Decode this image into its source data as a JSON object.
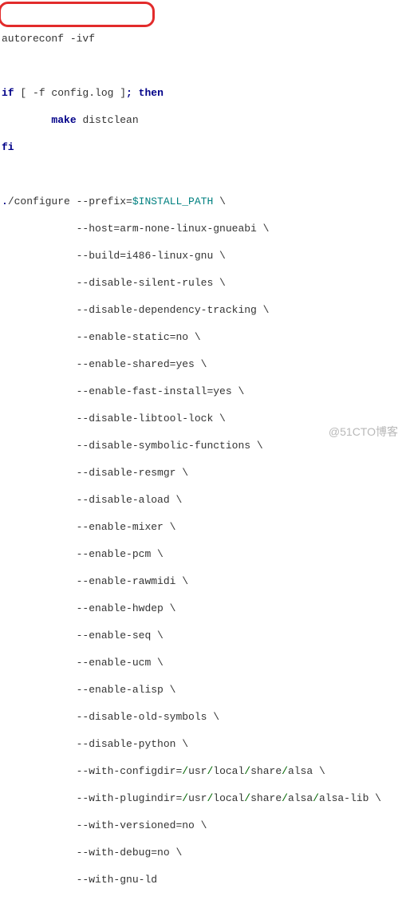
{
  "code": {
    "line1_cmd": "autoreconf -ivf",
    "line3_if": "if",
    "line3_cond": " [ -f config.log ]",
    "line3_semi": ";",
    "line3_then": " then",
    "line4_indent": "        ",
    "line4_make": "make",
    "line4_target": " distclean",
    "line5_fi": "fi",
    "cfg_dot": ".",
    "cfg_cmd": "/configure --prefix=",
    "cfg_var": "$INSTALL_PATH",
    "cfg_bs": " \\",
    "pad": "            ",
    "opt1": "--host=arm-none-linux-gnueabi \\",
    "opt2": "--build=i486-linux-gnu \\",
    "opt3": "--disable-silent-rules \\",
    "opt4": "--disable-dependency-tracking \\",
    "opt5": "--enable-static=no \\",
    "opt6": "--enable-shared=yes \\",
    "opt7": "--enable-fast-install=yes \\",
    "opt8": "--disable-libtool-lock \\",
    "opt9": "--disable-symbolic-functions \\",
    "opt10": "--disable-resmgr \\",
    "opt11": "--disable-aload \\",
    "opt12": "--enable-mixer \\",
    "opt13": "--enable-pcm \\",
    "opt14": "--enable-rawmidi \\",
    "opt15": "--enable-hwdep \\",
    "opt16": "--enable-seq \\",
    "opt17": "--enable-ucm \\",
    "opt18": "--enable-alisp \\",
    "opt19": "--disable-old-symbols \\",
    "opt20": "--disable-python \\",
    "opt21_a": "--with-configdir=",
    "opt21_b": "/",
    "opt21_c": "usr",
    "opt21_d": "local",
    "opt21_e": "share",
    "opt21_f": "alsa \\",
    "opt22_a": "--with-plugindir=",
    "opt22_f": "alsa",
    "opt22_g": "alsa-lib \\",
    "opt23": "--with-versioned=no \\",
    "opt24": "--with-debug=no \\",
    "opt25": "--with-gnu-ld"
  },
  "watermark": "@51CTO博客",
  "colors": {
    "highlight_border": "#e22b2b",
    "keyword": "#000088",
    "variable": "#008080",
    "slash": "#006600"
  }
}
